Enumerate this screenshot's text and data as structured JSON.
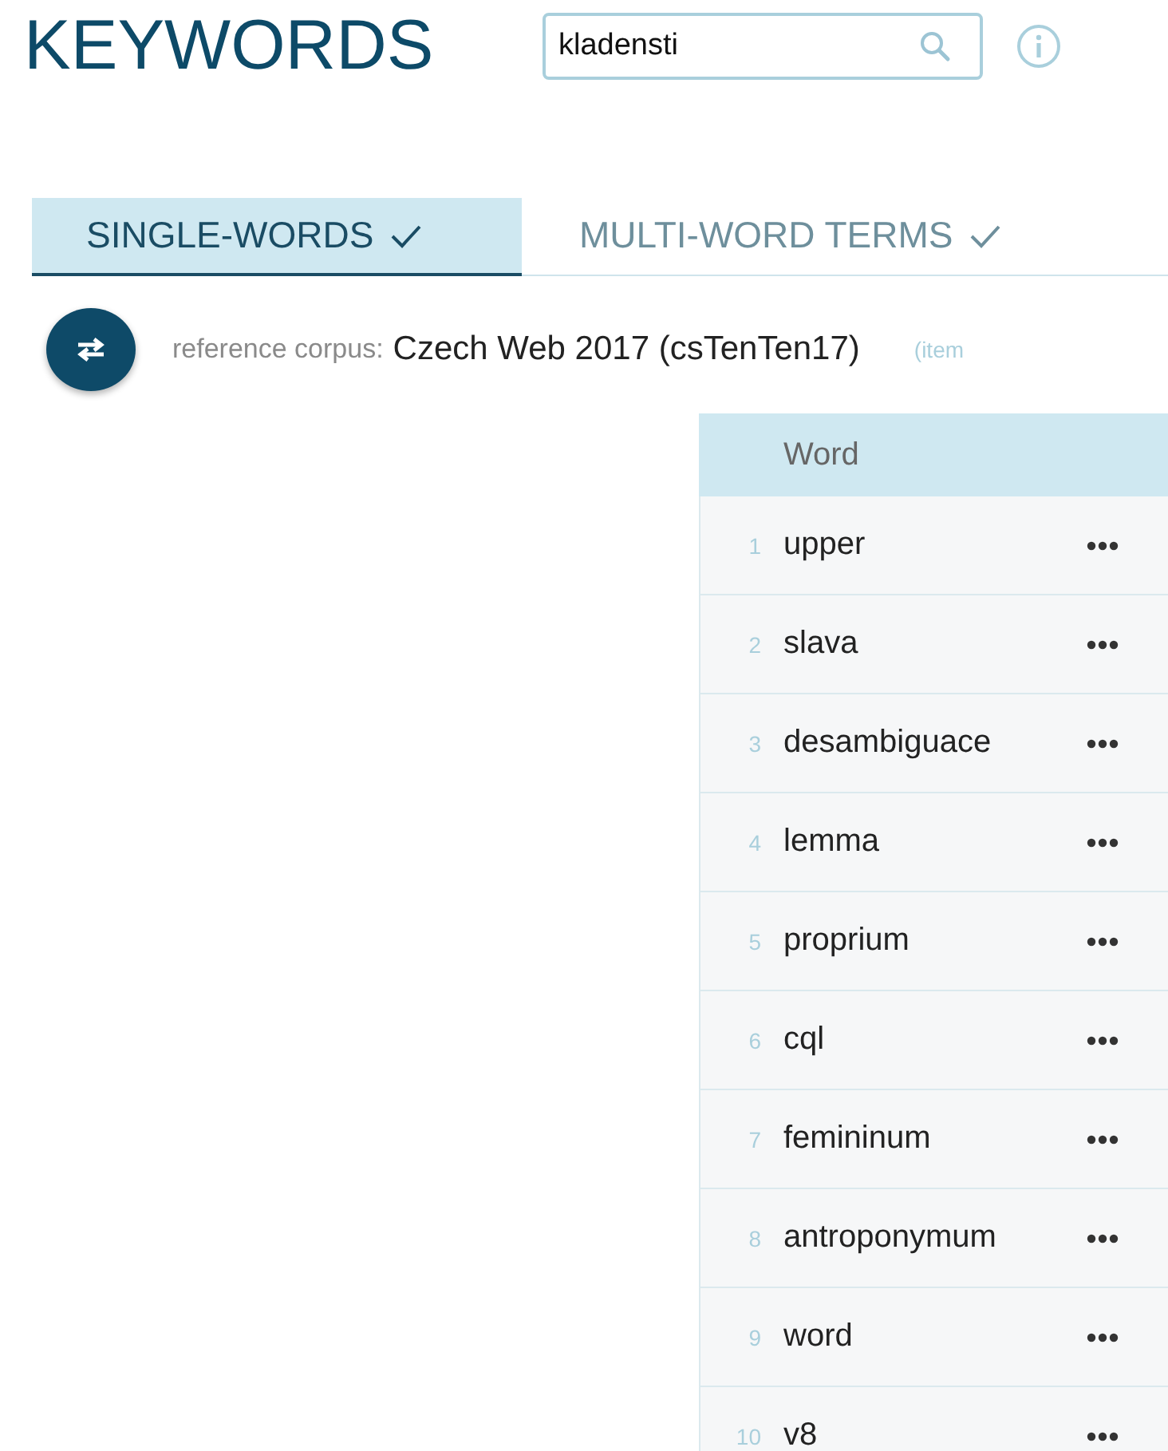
{
  "title": "KEYWORDS",
  "search": {
    "value": "kladensti"
  },
  "tabs": [
    {
      "label": "SINGLE-WORDS",
      "selected": true
    },
    {
      "label": "MULTI-WORD TERMS",
      "selected": false
    }
  ],
  "reference": {
    "label": "reference corpus:",
    "value": "Czech Web 2017 (csTenTen17)",
    "note": "(item"
  },
  "table": {
    "columns": [
      "Word"
    ],
    "rows": [
      {
        "rank": "1",
        "word": "upper"
      },
      {
        "rank": "2",
        "word": "slava"
      },
      {
        "rank": "3",
        "word": "desambiguace"
      },
      {
        "rank": "4",
        "word": "lemma"
      },
      {
        "rank": "5",
        "word": "proprium"
      },
      {
        "rank": "6",
        "word": "cql"
      },
      {
        "rank": "7",
        "word": "femininum"
      },
      {
        "rank": "8",
        "word": "antroponymum"
      },
      {
        "rank": "9",
        "word": "word"
      },
      {
        "rank": "10",
        "word": "v8"
      }
    ]
  }
}
